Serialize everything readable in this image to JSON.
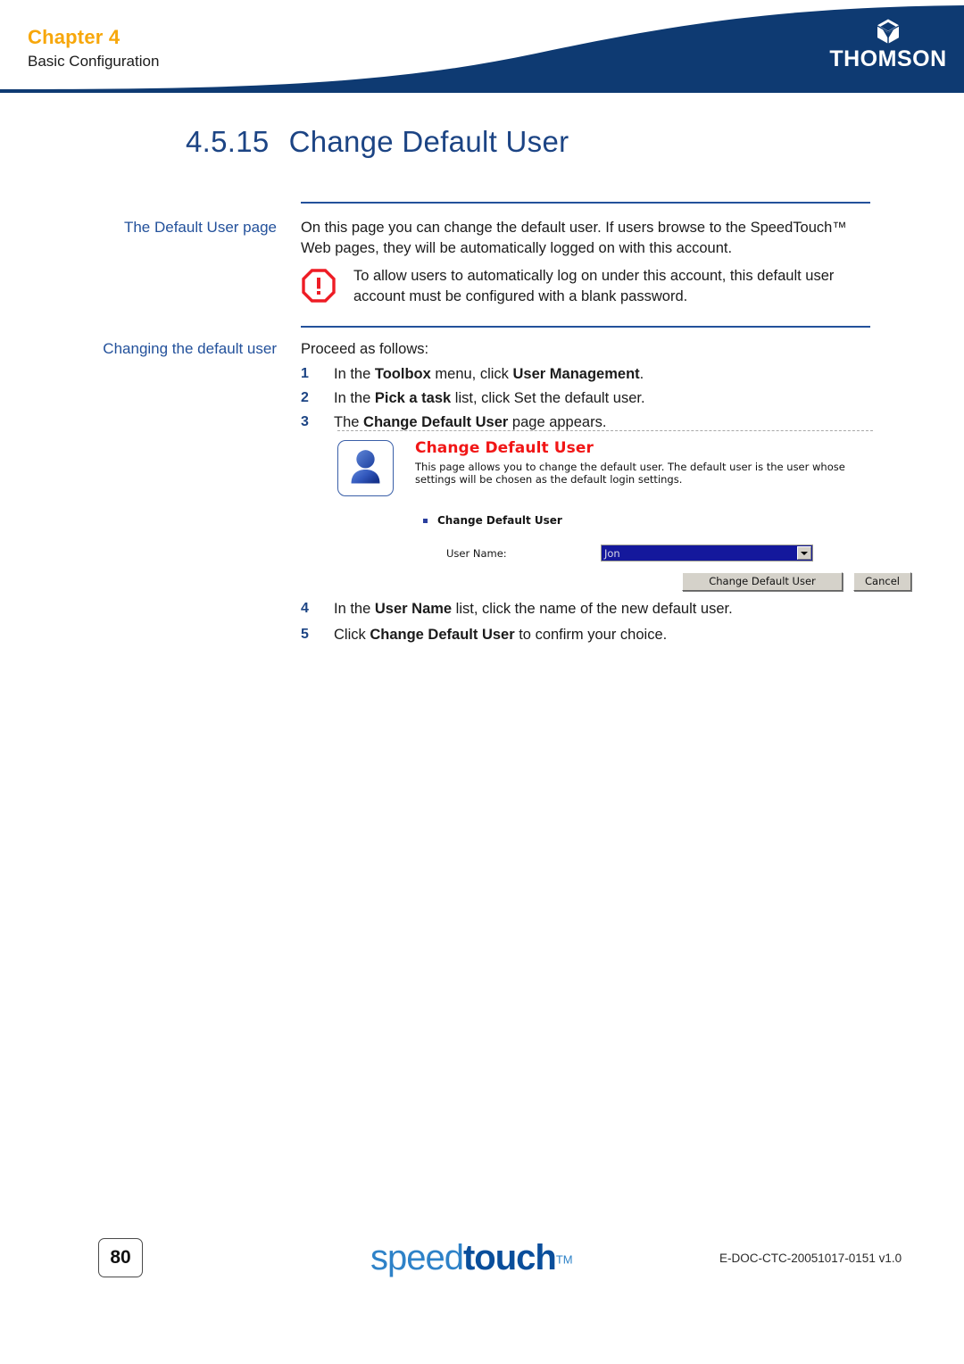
{
  "header": {
    "chapter_label": "Chapter 4",
    "chapter_subtitle": "Basic Configuration",
    "brand": "THOMSON",
    "brand_mark_icon": "thomson-cube-icon",
    "band_color": "#0e3a72"
  },
  "section": {
    "number": "4.5.15",
    "title": "Change Default User",
    "color": "#1c4484"
  },
  "blocks": {
    "default_user_page": {
      "side_label": "The Default User page",
      "paragraph": "On this page you can change the default user. If users browse to the SpeedTouch™ Web pages, they will be automatically logged on with this account.",
      "note_icon": "warning-octagon-icon",
      "note_text": "To allow users to automatically log on under this account, this default user account must be configured with a blank password."
    },
    "changing_default_user": {
      "side_label": "Changing the default user",
      "intro": "Proceed as follows:",
      "steps": [
        {
          "num": "1",
          "pre": "In the ",
          "bold1": "Toolbox",
          "mid": " menu, click ",
          "bold2": "User Management",
          "post": "."
        },
        {
          "num": "2",
          "pre": "In the ",
          "bold1": "Pick a task",
          "mid": " list, click Set the default user.",
          "bold2": "",
          "post": ""
        },
        {
          "num": "3",
          "pre": "The ",
          "bold1": "Change Default User",
          "mid": " page appears.",
          "bold2": "",
          "post": ""
        },
        {
          "num": "4",
          "pre": "In the ",
          "bold1": "User Name",
          "mid": " list, click the name of the new default user.",
          "bold2": "",
          "post": ""
        },
        {
          "num": "5",
          "pre": "Click ",
          "bold1": "Change Default User",
          "mid": " to confirm your choice.",
          "bold2": "",
          "post": ""
        }
      ]
    }
  },
  "screenshot": {
    "avatar_icon": "user-avatar-icon",
    "title": "Change Default User",
    "title_color": "#f11616",
    "description": "This page allows you to change the default user. The default user is the user whose settings will be chosen as the default login settings.",
    "bullet_label": "Change Default User",
    "bullet_icon": "square-bullet-icon",
    "field_label": "User Name:",
    "field_value": "Jon",
    "field_dropdown_icon": "chevron-down-icon",
    "primary_button": "Change Default User",
    "cancel_button": "Cancel"
  },
  "footer": {
    "page_number": "80",
    "product_logo_part1": "speed",
    "product_logo_part2": "touch",
    "product_logo_tm": "TM",
    "doc_code": "E-DOC-CTC-20051017-0151 v1.0"
  }
}
